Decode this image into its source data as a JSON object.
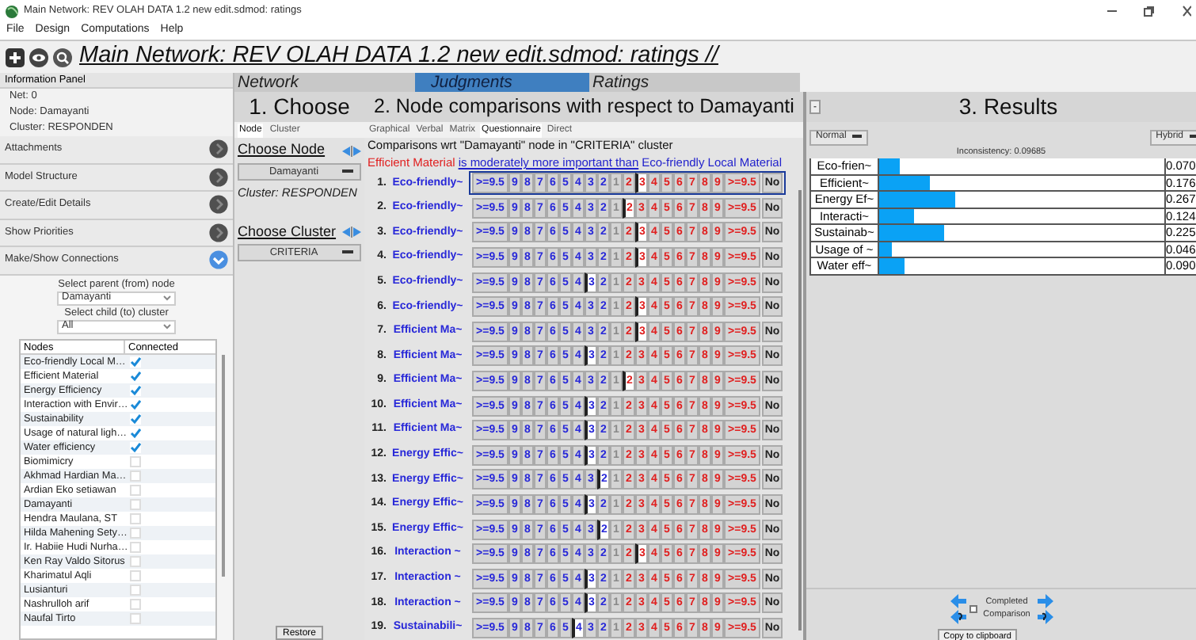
{
  "window": {
    "title": "Main Network: REV OLAH DATA 1.2 new edit.sdmod: ratings"
  },
  "menu": [
    "File",
    "Design",
    "Computations",
    "Help"
  ],
  "toolbar": {
    "path": "Main Network: REV OLAH DATA 1.2 new edit.sdmod: ratings //"
  },
  "info_panel": {
    "title": "Information Panel",
    "lines": [
      "Net: 0",
      "Node: Damayanti",
      "Cluster: RESPONDEN"
    ]
  },
  "sections": [
    {
      "label": "Attachments",
      "expanded": false
    },
    {
      "label": "Model Structure",
      "expanded": false
    },
    {
      "label": "Create/Edit Details",
      "expanded": false
    },
    {
      "label": "Show Priorities",
      "expanded": false
    },
    {
      "label": "Make/Show Connections",
      "expanded": true
    }
  ],
  "connections": {
    "parent_label": "Select parent (from) node",
    "parent_value": "Damayanti",
    "child_label": "Select child (to) cluster",
    "child_value": "All",
    "columns": [
      "Nodes",
      "Connected"
    ],
    "rows": [
      {
        "name": "Eco-friendly Local M…",
        "connected": true
      },
      {
        "name": "Efficient Material",
        "connected": true
      },
      {
        "name": "Energy Efficiency",
        "connected": true
      },
      {
        "name": "Interaction with Envir…",
        "connected": true
      },
      {
        "name": "Sustainability",
        "connected": true
      },
      {
        "name": "Usage of natural ligh…",
        "connected": true
      },
      {
        "name": "Water efficiency",
        "connected": true
      },
      {
        "name": "Biomimicry",
        "connected": false
      },
      {
        "name": "Akhmad Hardian Ma…",
        "connected": false
      },
      {
        "name": "Ardian Eko setiawan",
        "connected": false
      },
      {
        "name": "Damayanti",
        "connected": false
      },
      {
        "name": "Hendra Maulana, ST",
        "connected": false
      },
      {
        "name": "Hilda Mahening Sety…",
        "connected": false
      },
      {
        "name": "Ir. Habiie Hudi Nurha…",
        "connected": false
      },
      {
        "name": "Ken Ray Valdo Sitorus",
        "connected": false
      },
      {
        "name": "Kharimatul Aqli",
        "connected": false
      },
      {
        "name": "Lusianturi",
        "connected": false
      },
      {
        "name": "Nashrulloh arif",
        "connected": false
      },
      {
        "name": "Naufal Tirto",
        "connected": false
      }
    ]
  },
  "main_tabs": [
    {
      "label": "Network",
      "selected": false
    },
    {
      "label": "Judgments",
      "selected": true
    },
    {
      "label": "Ratings",
      "selected": false
    }
  ],
  "choose": {
    "heading": "1. Choose",
    "tabs": [
      {
        "label": "Node",
        "selected": true
      },
      {
        "label": "Cluster",
        "selected": false
      }
    ],
    "node_label": "Choose Node",
    "node_value": "Damayanti",
    "cluster_text": "Cluster: RESPONDEN",
    "cluster_label": "Choose Cluster",
    "cluster_value": "CRITERIA",
    "restore": "Restore"
  },
  "comparisons": {
    "heading": "2. Node comparisons with respect to Damayanti",
    "modes": [
      {
        "label": "Graphical",
        "selected": false
      },
      {
        "label": "Verbal",
        "selected": false
      },
      {
        "label": "Matrix",
        "selected": false
      },
      {
        "label": "Questionnaire",
        "selected": true
      },
      {
        "label": "Direct",
        "selected": false
      }
    ],
    "caption": "Comparisons wrt \"Damayanti\" node in \"CRITERIA\" cluster",
    "statement": [
      {
        "text": "Efficient Material",
        "kind": "node_right"
      },
      {
        "text": "is moderately more important than",
        "kind": "phrase"
      },
      {
        "text": "Eco-friendly Local Material",
        "kind": "node_left"
      }
    ],
    "rows": [
      {
        "number": "1.",
        "label": "Eco-friendly~",
        "selected": true,
        "cells": [
          {
            "text": ">=9.5",
            "selected": false
          },
          {
            "text": "9",
            "selected": false
          },
          {
            "text": "8",
            "selected": false
          },
          {
            "text": "7",
            "selected": false
          },
          {
            "text": "6",
            "selected": false
          },
          {
            "text": "5",
            "selected": false
          },
          {
            "text": "4",
            "selected": false
          },
          {
            "text": "3",
            "selected": false
          },
          {
            "text": "2",
            "selected": false
          },
          {
            "text": "1",
            "selected": false
          },
          {
            "text": "2",
            "selected": false
          },
          {
            "text": "3",
            "selected": true
          },
          {
            "text": "4",
            "selected": false
          },
          {
            "text": "5",
            "selected": false
          },
          {
            "text": "6",
            "selected": false
          },
          {
            "text": "7",
            "selected": false
          },
          {
            "text": "8",
            "selected": false
          },
          {
            "text": "9",
            "selected": false
          },
          {
            "text": ">=9.5",
            "selected": false
          },
          {
            "text": "No",
            "selected": false
          }
        ]
      },
      {
        "number": "2.",
        "label": "Eco-friendly~",
        "selected": false,
        "cells": [
          {
            "text": ">=9.5",
            "selected": false
          },
          {
            "text": "9",
            "selected": false
          },
          {
            "text": "8",
            "selected": false
          },
          {
            "text": "7",
            "selected": false
          },
          {
            "text": "6",
            "selected": false
          },
          {
            "text": "5",
            "selected": false
          },
          {
            "text": "4",
            "selected": false
          },
          {
            "text": "3",
            "selected": false
          },
          {
            "text": "2",
            "selected": false
          },
          {
            "text": "1",
            "selected": false
          },
          {
            "text": "2",
            "selected": true
          },
          {
            "text": "3",
            "selected": false
          },
          {
            "text": "4",
            "selected": false
          },
          {
            "text": "5",
            "selected": false
          },
          {
            "text": "6",
            "selected": false
          },
          {
            "text": "7",
            "selected": false
          },
          {
            "text": "8",
            "selected": false
          },
          {
            "text": "9",
            "selected": false
          },
          {
            "text": ">=9.5",
            "selected": false
          },
          {
            "text": "No",
            "selected": false
          }
        ]
      },
      {
        "number": "3.",
        "label": "Eco-friendly~",
        "selected": false,
        "cells": [
          {
            "text": ">=9.5",
            "selected": false
          },
          {
            "text": "9",
            "selected": false
          },
          {
            "text": "8",
            "selected": false
          },
          {
            "text": "7",
            "selected": false
          },
          {
            "text": "6",
            "selected": false
          },
          {
            "text": "5",
            "selected": false
          },
          {
            "text": "4",
            "selected": false
          },
          {
            "text": "3",
            "selected": false
          },
          {
            "text": "2",
            "selected": false
          },
          {
            "text": "1",
            "selected": false
          },
          {
            "text": "2",
            "selected": false
          },
          {
            "text": "3",
            "selected": true
          },
          {
            "text": "4",
            "selected": false
          },
          {
            "text": "5",
            "selected": false
          },
          {
            "text": "6",
            "selected": false
          },
          {
            "text": "7",
            "selected": false
          },
          {
            "text": "8",
            "selected": false
          },
          {
            "text": "9",
            "selected": false
          },
          {
            "text": ">=9.5",
            "selected": false
          },
          {
            "text": "No",
            "selected": false
          }
        ]
      },
      {
        "number": "4.",
        "label": "Eco-friendly~",
        "selected": false,
        "cells": [
          {
            "text": ">=9.5",
            "selected": false
          },
          {
            "text": "9",
            "selected": false
          },
          {
            "text": "8",
            "selected": false
          },
          {
            "text": "7",
            "selected": false
          },
          {
            "text": "6",
            "selected": false
          },
          {
            "text": "5",
            "selected": false
          },
          {
            "text": "4",
            "selected": false
          },
          {
            "text": "3",
            "selected": false
          },
          {
            "text": "2",
            "selected": false
          },
          {
            "text": "1",
            "selected": false
          },
          {
            "text": "2",
            "selected": false
          },
          {
            "text": "3",
            "selected": true
          },
          {
            "text": "4",
            "selected": false
          },
          {
            "text": "5",
            "selected": false
          },
          {
            "text": "6",
            "selected": false
          },
          {
            "text": "7",
            "selected": false
          },
          {
            "text": "8",
            "selected": false
          },
          {
            "text": "9",
            "selected": false
          },
          {
            "text": ">=9.5",
            "selected": false
          },
          {
            "text": "No",
            "selected": false
          }
        ]
      },
      {
        "number": "5.",
        "label": "Eco-friendly~",
        "selected": false,
        "cells": [
          {
            "text": ">=9.5",
            "selected": false
          },
          {
            "text": "9",
            "selected": false
          },
          {
            "text": "8",
            "selected": false
          },
          {
            "text": "7",
            "selected": false
          },
          {
            "text": "6",
            "selected": false
          },
          {
            "text": "5",
            "selected": false
          },
          {
            "text": "4",
            "selected": false
          },
          {
            "text": "3",
            "selected": true
          },
          {
            "text": "2",
            "selected": false
          },
          {
            "text": "1",
            "selected": false
          },
          {
            "text": "2",
            "selected": false
          },
          {
            "text": "3",
            "selected": false
          },
          {
            "text": "4",
            "selected": false
          },
          {
            "text": "5",
            "selected": false
          },
          {
            "text": "6",
            "selected": false
          },
          {
            "text": "7",
            "selected": false
          },
          {
            "text": "8",
            "selected": false
          },
          {
            "text": "9",
            "selected": false
          },
          {
            "text": ">=9.5",
            "selected": false
          },
          {
            "text": "No",
            "selected": false
          }
        ]
      },
      {
        "number": "6.",
        "label": "Eco-friendly~",
        "selected": false,
        "cells": [
          {
            "text": ">=9.5",
            "selected": false
          },
          {
            "text": "9",
            "selected": false
          },
          {
            "text": "8",
            "selected": false
          },
          {
            "text": "7",
            "selected": false
          },
          {
            "text": "6",
            "selected": false
          },
          {
            "text": "5",
            "selected": false
          },
          {
            "text": "4",
            "selected": false
          },
          {
            "text": "3",
            "selected": false
          },
          {
            "text": "2",
            "selected": false
          },
          {
            "text": "1",
            "selected": false
          },
          {
            "text": "2",
            "selected": false
          },
          {
            "text": "3",
            "selected": true
          },
          {
            "text": "4",
            "selected": false
          },
          {
            "text": "5",
            "selected": false
          },
          {
            "text": "6",
            "selected": false
          },
          {
            "text": "7",
            "selected": false
          },
          {
            "text": "8",
            "selected": false
          },
          {
            "text": "9",
            "selected": false
          },
          {
            "text": ">=9.5",
            "selected": false
          },
          {
            "text": "No",
            "selected": false
          }
        ]
      },
      {
        "number": "7.",
        "label": "Efficient Ma~",
        "selected": false,
        "cells": [
          {
            "text": ">=9.5",
            "selected": false
          },
          {
            "text": "9",
            "selected": false
          },
          {
            "text": "8",
            "selected": false
          },
          {
            "text": "7",
            "selected": false
          },
          {
            "text": "6",
            "selected": false
          },
          {
            "text": "5",
            "selected": false
          },
          {
            "text": "4",
            "selected": false
          },
          {
            "text": "3",
            "selected": false
          },
          {
            "text": "2",
            "selected": false
          },
          {
            "text": "1",
            "selected": false
          },
          {
            "text": "2",
            "selected": false
          },
          {
            "text": "3",
            "selected": true
          },
          {
            "text": "4",
            "selected": false
          },
          {
            "text": "5",
            "selected": false
          },
          {
            "text": "6",
            "selected": false
          },
          {
            "text": "7",
            "selected": false
          },
          {
            "text": "8",
            "selected": false
          },
          {
            "text": "9",
            "selected": false
          },
          {
            "text": ">=9.5",
            "selected": false
          },
          {
            "text": "No",
            "selected": false
          }
        ]
      },
      {
        "number": "8.",
        "label": "Efficient Ma~",
        "selected": false,
        "cells": [
          {
            "text": ">=9.5",
            "selected": false
          },
          {
            "text": "9",
            "selected": false
          },
          {
            "text": "8",
            "selected": false
          },
          {
            "text": "7",
            "selected": false
          },
          {
            "text": "6",
            "selected": false
          },
          {
            "text": "5",
            "selected": false
          },
          {
            "text": "4",
            "selected": false
          },
          {
            "text": "3",
            "selected": true
          },
          {
            "text": "2",
            "selected": false
          },
          {
            "text": "1",
            "selected": false
          },
          {
            "text": "2",
            "selected": false
          },
          {
            "text": "3",
            "selected": false
          },
          {
            "text": "4",
            "selected": false
          },
          {
            "text": "5",
            "selected": false
          },
          {
            "text": "6",
            "selected": false
          },
          {
            "text": "7",
            "selected": false
          },
          {
            "text": "8",
            "selected": false
          },
          {
            "text": "9",
            "selected": false
          },
          {
            "text": ">=9.5",
            "selected": false
          },
          {
            "text": "No",
            "selected": false
          }
        ]
      },
      {
        "number": "9.",
        "label": "Efficient Ma~",
        "selected": false,
        "cells": [
          {
            "text": ">=9.5",
            "selected": false
          },
          {
            "text": "9",
            "selected": false
          },
          {
            "text": "8",
            "selected": false
          },
          {
            "text": "7",
            "selected": false
          },
          {
            "text": "6",
            "selected": false
          },
          {
            "text": "5",
            "selected": false
          },
          {
            "text": "4",
            "selected": false
          },
          {
            "text": "3",
            "selected": false
          },
          {
            "text": "2",
            "selected": false
          },
          {
            "text": "1",
            "selected": false
          },
          {
            "text": "2",
            "selected": true
          },
          {
            "text": "3",
            "selected": false
          },
          {
            "text": "4",
            "selected": false
          },
          {
            "text": "5",
            "selected": false
          },
          {
            "text": "6",
            "selected": false
          },
          {
            "text": "7",
            "selected": false
          },
          {
            "text": "8",
            "selected": false
          },
          {
            "text": "9",
            "selected": false
          },
          {
            "text": ">=9.5",
            "selected": false
          },
          {
            "text": "No",
            "selected": false
          }
        ]
      },
      {
        "number": "10.",
        "label": "Efficient Ma~",
        "selected": false,
        "cells": [
          {
            "text": ">=9.5",
            "selected": false
          },
          {
            "text": "9",
            "selected": false
          },
          {
            "text": "8",
            "selected": false
          },
          {
            "text": "7",
            "selected": false
          },
          {
            "text": "6",
            "selected": false
          },
          {
            "text": "5",
            "selected": false
          },
          {
            "text": "4",
            "selected": false
          },
          {
            "text": "3",
            "selected": true
          },
          {
            "text": "2",
            "selected": false
          },
          {
            "text": "1",
            "selected": false
          },
          {
            "text": "2",
            "selected": false
          },
          {
            "text": "3",
            "selected": false
          },
          {
            "text": "4",
            "selected": false
          },
          {
            "text": "5",
            "selected": false
          },
          {
            "text": "6",
            "selected": false
          },
          {
            "text": "7",
            "selected": false
          },
          {
            "text": "8",
            "selected": false
          },
          {
            "text": "9",
            "selected": false
          },
          {
            "text": ">=9.5",
            "selected": false
          },
          {
            "text": "No",
            "selected": false
          }
        ]
      },
      {
        "number": "11.",
        "label": "Efficient Ma~",
        "selected": false,
        "cells": [
          {
            "text": ">=9.5",
            "selected": false
          },
          {
            "text": "9",
            "selected": false
          },
          {
            "text": "8",
            "selected": false
          },
          {
            "text": "7",
            "selected": false
          },
          {
            "text": "6",
            "selected": false
          },
          {
            "text": "5",
            "selected": false
          },
          {
            "text": "4",
            "selected": false
          },
          {
            "text": "3",
            "selected": true
          },
          {
            "text": "2",
            "selected": false
          },
          {
            "text": "1",
            "selected": false
          },
          {
            "text": "2",
            "selected": false
          },
          {
            "text": "3",
            "selected": false
          },
          {
            "text": "4",
            "selected": false
          },
          {
            "text": "5",
            "selected": false
          },
          {
            "text": "6",
            "selected": false
          },
          {
            "text": "7",
            "selected": false
          },
          {
            "text": "8",
            "selected": false
          },
          {
            "text": "9",
            "selected": false
          },
          {
            "text": ">=9.5",
            "selected": false
          },
          {
            "text": "No",
            "selected": false
          }
        ]
      },
      {
        "number": "12.",
        "label": "Energy Effic~",
        "selected": false,
        "cells": [
          {
            "text": ">=9.5",
            "selected": false
          },
          {
            "text": "9",
            "selected": false
          },
          {
            "text": "8",
            "selected": false
          },
          {
            "text": "7",
            "selected": false
          },
          {
            "text": "6",
            "selected": false
          },
          {
            "text": "5",
            "selected": false
          },
          {
            "text": "4",
            "selected": false
          },
          {
            "text": "3",
            "selected": true
          },
          {
            "text": "2",
            "selected": false
          },
          {
            "text": "1",
            "selected": false
          },
          {
            "text": "2",
            "selected": false
          },
          {
            "text": "3",
            "selected": false
          },
          {
            "text": "4",
            "selected": false
          },
          {
            "text": "5",
            "selected": false
          },
          {
            "text": "6",
            "selected": false
          },
          {
            "text": "7",
            "selected": false
          },
          {
            "text": "8",
            "selected": false
          },
          {
            "text": "9",
            "selected": false
          },
          {
            "text": ">=9.5",
            "selected": false
          },
          {
            "text": "No",
            "selected": false
          }
        ]
      },
      {
        "number": "13.",
        "label": "Energy Effic~",
        "selected": false,
        "cells": [
          {
            "text": ">=9.5",
            "selected": false
          },
          {
            "text": "9",
            "selected": false
          },
          {
            "text": "8",
            "selected": false
          },
          {
            "text": "7",
            "selected": false
          },
          {
            "text": "6",
            "selected": false
          },
          {
            "text": "5",
            "selected": false
          },
          {
            "text": "4",
            "selected": false
          },
          {
            "text": "3",
            "selected": false
          },
          {
            "text": "2",
            "selected": true
          },
          {
            "text": "1",
            "selected": false
          },
          {
            "text": "2",
            "selected": false
          },
          {
            "text": "3",
            "selected": false
          },
          {
            "text": "4",
            "selected": false
          },
          {
            "text": "5",
            "selected": false
          },
          {
            "text": "6",
            "selected": false
          },
          {
            "text": "7",
            "selected": false
          },
          {
            "text": "8",
            "selected": false
          },
          {
            "text": "9",
            "selected": false
          },
          {
            "text": ">=9.5",
            "selected": false
          },
          {
            "text": "No",
            "selected": false
          }
        ]
      },
      {
        "number": "14.",
        "label": "Energy Effic~",
        "selected": false,
        "cells": [
          {
            "text": ">=9.5",
            "selected": false
          },
          {
            "text": "9",
            "selected": false
          },
          {
            "text": "8",
            "selected": false
          },
          {
            "text": "7",
            "selected": false
          },
          {
            "text": "6",
            "selected": false
          },
          {
            "text": "5",
            "selected": false
          },
          {
            "text": "4",
            "selected": false
          },
          {
            "text": "3",
            "selected": true
          },
          {
            "text": "2",
            "selected": false
          },
          {
            "text": "1",
            "selected": false
          },
          {
            "text": "2",
            "selected": false
          },
          {
            "text": "3",
            "selected": false
          },
          {
            "text": "4",
            "selected": false
          },
          {
            "text": "5",
            "selected": false
          },
          {
            "text": "6",
            "selected": false
          },
          {
            "text": "7",
            "selected": false
          },
          {
            "text": "8",
            "selected": false
          },
          {
            "text": "9",
            "selected": false
          },
          {
            "text": ">=9.5",
            "selected": false
          },
          {
            "text": "No",
            "selected": false
          }
        ]
      },
      {
        "number": "15.",
        "label": "Energy Effic~",
        "selected": false,
        "cells": [
          {
            "text": ">=9.5",
            "selected": false
          },
          {
            "text": "9",
            "selected": false
          },
          {
            "text": "8",
            "selected": false
          },
          {
            "text": "7",
            "selected": false
          },
          {
            "text": "6",
            "selected": false
          },
          {
            "text": "5",
            "selected": false
          },
          {
            "text": "4",
            "selected": false
          },
          {
            "text": "3",
            "selected": false
          },
          {
            "text": "2",
            "selected": true
          },
          {
            "text": "1",
            "selected": false
          },
          {
            "text": "2",
            "selected": false
          },
          {
            "text": "3",
            "selected": false
          },
          {
            "text": "4",
            "selected": false
          },
          {
            "text": "5",
            "selected": false
          },
          {
            "text": "6",
            "selected": false
          },
          {
            "text": "7",
            "selected": false
          },
          {
            "text": "8",
            "selected": false
          },
          {
            "text": "9",
            "selected": false
          },
          {
            "text": ">=9.5",
            "selected": false
          },
          {
            "text": "No",
            "selected": false
          }
        ]
      },
      {
        "number": "16.",
        "label": "Interaction ~",
        "selected": false,
        "cells": [
          {
            "text": ">=9.5",
            "selected": false
          },
          {
            "text": "9",
            "selected": false
          },
          {
            "text": "8",
            "selected": false
          },
          {
            "text": "7",
            "selected": false
          },
          {
            "text": "6",
            "selected": false
          },
          {
            "text": "5",
            "selected": false
          },
          {
            "text": "4",
            "selected": false
          },
          {
            "text": "3",
            "selected": false
          },
          {
            "text": "2",
            "selected": false
          },
          {
            "text": "1",
            "selected": false
          },
          {
            "text": "2",
            "selected": false
          },
          {
            "text": "3",
            "selected": true
          },
          {
            "text": "4",
            "selected": false
          },
          {
            "text": "5",
            "selected": false
          },
          {
            "text": "6",
            "selected": false
          },
          {
            "text": "7",
            "selected": false
          },
          {
            "text": "8",
            "selected": false
          },
          {
            "text": "9",
            "selected": false
          },
          {
            "text": ">=9.5",
            "selected": false
          },
          {
            "text": "No",
            "selected": false
          }
        ]
      },
      {
        "number": "17.",
        "label": "Interaction ~",
        "selected": false,
        "cells": [
          {
            "text": ">=9.5",
            "selected": false
          },
          {
            "text": "9",
            "selected": false
          },
          {
            "text": "8",
            "selected": false
          },
          {
            "text": "7",
            "selected": false
          },
          {
            "text": "6",
            "selected": false
          },
          {
            "text": "5",
            "selected": false
          },
          {
            "text": "4",
            "selected": false
          },
          {
            "text": "3",
            "selected": true
          },
          {
            "text": "2",
            "selected": false
          },
          {
            "text": "1",
            "selected": false
          },
          {
            "text": "2",
            "selected": false
          },
          {
            "text": "3",
            "selected": false
          },
          {
            "text": "4",
            "selected": false
          },
          {
            "text": "5",
            "selected": false
          },
          {
            "text": "6",
            "selected": false
          },
          {
            "text": "7",
            "selected": false
          },
          {
            "text": "8",
            "selected": false
          },
          {
            "text": "9",
            "selected": false
          },
          {
            "text": ">=9.5",
            "selected": false
          },
          {
            "text": "No",
            "selected": false
          }
        ]
      },
      {
        "number": "18.",
        "label": "Interaction ~",
        "selected": false,
        "cells": [
          {
            "text": ">=9.5",
            "selected": false
          },
          {
            "text": "9",
            "selected": false
          },
          {
            "text": "8",
            "selected": false
          },
          {
            "text": "7",
            "selected": false
          },
          {
            "text": "6",
            "selected": false
          },
          {
            "text": "5",
            "selected": false
          },
          {
            "text": "4",
            "selected": false
          },
          {
            "text": "3",
            "selected": true
          },
          {
            "text": "2",
            "selected": false
          },
          {
            "text": "1",
            "selected": false
          },
          {
            "text": "2",
            "selected": false
          },
          {
            "text": "3",
            "selected": false
          },
          {
            "text": "4",
            "selected": false
          },
          {
            "text": "5",
            "selected": false
          },
          {
            "text": "6",
            "selected": false
          },
          {
            "text": "7",
            "selected": false
          },
          {
            "text": "8",
            "selected": false
          },
          {
            "text": "9",
            "selected": false
          },
          {
            "text": ">=9.5",
            "selected": false
          },
          {
            "text": "No",
            "selected": false
          }
        ]
      },
      {
        "number": "19.",
        "label": "Sustainabili~",
        "selected": false,
        "cells": [
          {
            "text": ">=9.5",
            "selected": false
          },
          {
            "text": "9",
            "selected": false
          },
          {
            "text": "8",
            "selected": false
          },
          {
            "text": "7",
            "selected": false
          },
          {
            "text": "6",
            "selected": false
          },
          {
            "text": "5",
            "selected": false
          },
          {
            "text": "4",
            "selected": true
          },
          {
            "text": "3",
            "selected": false
          },
          {
            "text": "2",
            "selected": false
          },
          {
            "text": "1",
            "selected": false
          },
          {
            "text": "2",
            "selected": false
          },
          {
            "text": "3",
            "selected": false
          },
          {
            "text": "4",
            "selected": false
          },
          {
            "text": "5",
            "selected": false
          },
          {
            "text": "6",
            "selected": false
          },
          {
            "text": "7",
            "selected": false
          },
          {
            "text": "8",
            "selected": false
          },
          {
            "text": "9",
            "selected": false
          },
          {
            "text": ">=9.5",
            "selected": false
          },
          {
            "text": "No",
            "selected": false
          }
        ]
      }
    ]
  },
  "results": {
    "collapse": "-",
    "heading": "3. Results",
    "mode": "Normal",
    "view": "Hybrid",
    "inconsistency": "Inconsistency: 0.09685",
    "bars": [
      {
        "label": "Eco-frien~",
        "level": 0.07,
        "reading": "0.070"
      },
      {
        "label": "Efficient~",
        "level": 0.176,
        "reading": "0.176"
      },
      {
        "label": "Energy Ef~",
        "level": 0.267,
        "reading": "0.267"
      },
      {
        "label": "Interacti~",
        "level": 0.124,
        "reading": "0.124"
      },
      {
        "label": "Sustainab~",
        "level": 0.225,
        "reading": "0.225"
      },
      {
        "label": "Usage of ~",
        "level": 0.046,
        "reading": "0.046"
      },
      {
        "label": "Water eff~",
        "level": 0.09,
        "reading": "0.090"
      }
    ],
    "completed": {
      "label": "Completed Comparison",
      "checked": false
    },
    "copy": "Copy to clipboard"
  }
}
